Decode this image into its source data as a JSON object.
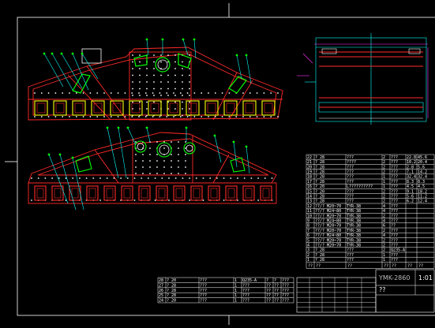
{
  "drawing": {
    "code": "YMK-2860",
    "sheet_ratio": "1:01",
    "subtitle": "??",
    "background": "#000000",
    "colors": {
      "frame": "#ffffff",
      "outline": "#ff2a2a",
      "bolt": "#ffffff",
      "stiffener": "#00ff00",
      "flange": "#ffff00",
      "leader": "#00ffff",
      "dim": "#ff33ff",
      "table_line": "#ffffff",
      "cell_fill_a": "#00ff00",
      "cell_fill_b": "#ffff00"
    }
  },
  "title_block": {
    "left_rows": [
      [
        "28",
        "?_20",
        "???",
        "1",
        "Q235-A",
        "?",
        "?",
        "???"
      ],
      [
        "27",
        "?_28",
        "???",
        "1",
        "???",
        "??",
        "??",
        "???"
      ],
      [
        "26",
        "?_28",
        "???",
        "1",
        "???",
        "??",
        "??",
        "???"
      ],
      [
        "25",
        "?_28",
        "???",
        "1",
        "???",
        "??",
        "??",
        "???"
      ],
      [
        "24",
        "?_20",
        "???",
        "1",
        "???",
        "??",
        "??",
        "???"
      ]
    ],
    "right_rows": [
      [
        "22",
        "?_28",
        "???",
        "2",
        "???",
        "22.8",
        "45.6"
      ],
      [
        "21",
        "?_28",
        "????",
        "2",
        "???",
        "10.2",
        "20.4"
      ],
      [
        "20",
        "?_28",
        "???",
        "2",
        "???",
        "2.8",
        "5.6"
      ],
      [
        "19",
        "?_28",
        "???",
        "2",
        "???",
        "7.1",
        "14.2"
      ],
      [
        "18",
        "?_28",
        "???",
        "1",
        "???",
        "32.4",
        "32.4"
      ],
      [
        "17",
        "?_28",
        "???",
        "1",
        "???",
        "8.3",
        "8.3"
      ],
      [
        "16",
        "?_20",
        "L??????????",
        "1",
        "???",
        "4.5",
        "4.5"
      ],
      [
        "15",
        "?_20",
        "???",
        "2",
        "???",
        "9.1",
        "18.2"
      ],
      [
        "14",
        "?_28",
        "???",
        "2",
        "???",
        "5.6",
        "11.2"
      ],
      [
        "13",
        "?_28",
        "???",
        "2",
        "???",
        "6.2",
        "12.4"
      ],
      [
        "12",
        "??/? M20~70",
        "TYR-38",
        "4",
        "???",
        "",
        ""
      ],
      [
        "11",
        "??/? M24~80",
        "TYR-38",
        "4",
        "???",
        "",
        ""
      ],
      [
        "10",
        "??/? M20~70",
        "TYR-38",
        "2",
        "???",
        "",
        ""
      ],
      [
        "9",
        "??/? M24~80",
        "TYR-38",
        "4",
        "???",
        "",
        ""
      ],
      [
        "8",
        "??/? M20~70",
        "TYR-38",
        "6",
        "??",
        "",
        ""
      ],
      [
        "7",
        "??/? M20~70",
        "TYR-38",
        "2",
        "???",
        "",
        ""
      ],
      [
        "6",
        "??/? M24~80",
        "TYR-38",
        "4",
        "???",
        "",
        ""
      ],
      [
        "5",
        "??/? M20~70",
        "TYR-38",
        "2",
        "???",
        "",
        ""
      ],
      [
        "4",
        "??/? M20~70",
        "TYR-38",
        "2",
        "???",
        "",
        ""
      ],
      [
        "3",
        "?_28",
        "???",
        "2",
        "Q235-A",
        "",
        ""
      ],
      [
        "2",
        "?_28",
        "???",
        "1",
        "???",
        "",
        ""
      ],
      [
        "1",
        "?_28",
        "???",
        "1",
        "???",
        "",
        ""
      ]
    ],
    "header": [
      "??",
      "??",
      "??",
      "??",
      "??",
      "??",
      "??"
    ]
  }
}
